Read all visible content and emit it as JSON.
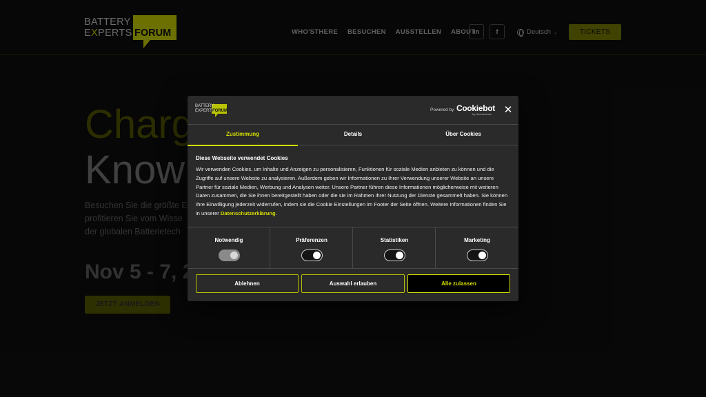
{
  "header": {
    "logo": {
      "line1": "BATTERY",
      "line2_e": "E",
      "line2_x": "X",
      "line2_rest": "PERTS",
      "boxed": "FORUM"
    },
    "nav": [
      "WHO'STHERE",
      "BESUCHEN",
      "AUSSTELLEN",
      "ABOUT"
    ],
    "social": {
      "linkedin": "in",
      "facebook": "f"
    },
    "language": "Deutsch",
    "tickets_label": "TICKETS"
  },
  "hero": {
    "line1": "Charg",
    "line2": "Know",
    "paragraph": [
      "Besuchen Sie die größte E",
      "profitieren Sie vom Wisse",
      "der globalen Batterietech"
    ],
    "date": "Nov 5 - 7, 2",
    "cta_label": "JETZT ANMELDEN"
  },
  "dialog": {
    "logo": {
      "line1": "BATTERY",
      "line2": "EXPERTS",
      "boxed": "FORUM"
    },
    "powered_by": "Powered by",
    "cookiebot": "Cookiebot",
    "cookiebot_sub": "by Usercentrics",
    "close_label": "✕",
    "tabs": [
      {
        "label": "Zustimmung",
        "active": true
      },
      {
        "label": "Details",
        "active": false
      },
      {
        "label": "Über Cookies",
        "active": false
      }
    ],
    "title": "Diese Webseite verwendet Cookies",
    "body": "Wir verwenden Cookies, um Inhalte und Anzeigen zu personalisieren, Funktionen für soziale Medien anbieten zu können und die Zugriffe auf unsere Website zu analysieren. Außerdem geben wir Informationen zu Ihrer Verwendung unserer Website an unsere Partner für soziale Medien, Werbung und Analysen weiter. Unsere Partner führen diese Informationen möglicherweise mit weiteren Daten zusammen, die Sie ihnen bereitgestellt haben oder die sie im Rahmen Ihrer Nutzung der Dienste gesammelt haben. Sie können Ihre Einwilligung jederzeit widerrufen, indem sie die Cookie Einstellungen im Footer der Seite öffnen. Weitere Informationen finden Sie in unserer ",
    "link_text": "Datenschutzerklärung",
    "body_end": ".",
    "consents": [
      {
        "label": "Notwendig",
        "checked": true,
        "disabled": true
      },
      {
        "label": "Präferenzen",
        "checked": false,
        "disabled": false
      },
      {
        "label": "Statistiken",
        "checked": false,
        "disabled": false
      },
      {
        "label": "Marketing",
        "checked": false,
        "disabled": false
      }
    ],
    "buttons": {
      "reject": "Ablehnen",
      "select": "Auswahl erlauben",
      "all": "Alle zulassen"
    },
    "colors": {
      "accent": "#d4df00",
      "brand": "#b8c200",
      "panel": "#2a2a2a"
    }
  }
}
